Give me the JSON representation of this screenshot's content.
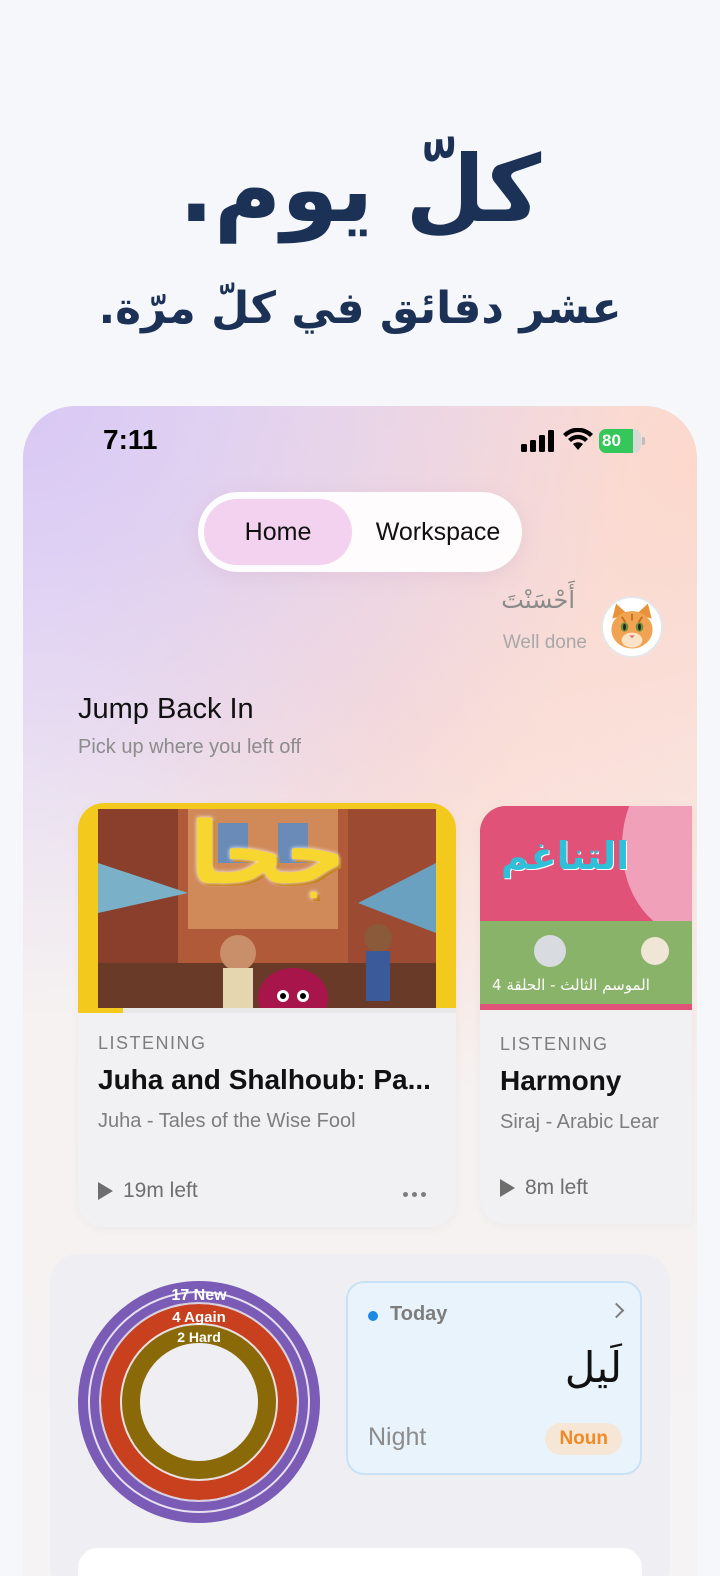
{
  "hero": {
    "title": "كلّ يوم.",
    "subtitle": "عشر دقائق في كلّ مرّة."
  },
  "status_bar": {
    "time": "7:11",
    "battery": "80",
    "battery_level": 0.8,
    "icons": [
      "cellular-signal-icon",
      "wifi-icon",
      "battery-charging-icon"
    ]
  },
  "tabs": {
    "home": "Home",
    "workspace": "Workspace",
    "selected": "Home"
  },
  "greeting": {
    "arabic": "أَحْسَنْتَ",
    "english": "Well done",
    "avatar": "cat-avatar"
  },
  "section": {
    "title": "Jump Back In",
    "subtitle": "Pick up where you left off"
  },
  "cards": [
    {
      "image_title": "جحا",
      "kind": "LISTENING",
      "title": "Juha and Shalhoub: Pa...",
      "subtitle": "Juha - Tales of the Wise Fool",
      "time_left": "19m left",
      "progress": 0.12
    },
    {
      "image_title": "التناغم",
      "image_caption": "الموسم الثالث - الحلقة 4",
      "kind": "LISTENING",
      "title": "Harmony",
      "subtitle": "Siraj - Arabic Lear",
      "time_left": "8m left"
    }
  ],
  "review_rings": {
    "new": "17 New",
    "again": "4 Again",
    "hard": "2 Hard",
    "colors": {
      "new": "#7a5cb6",
      "again": "#c8401e",
      "hard": "#8a6a08"
    }
  },
  "word_of_day": {
    "label": "Today",
    "word": "لَيل",
    "translation": "Night",
    "part_of_speech": "Noun"
  },
  "colors": {
    "hero_text": "#1c3156",
    "tab_selected": "#f2d2ee",
    "accent_orange": "#f08a24",
    "accent_blue": "#1e88e5"
  }
}
